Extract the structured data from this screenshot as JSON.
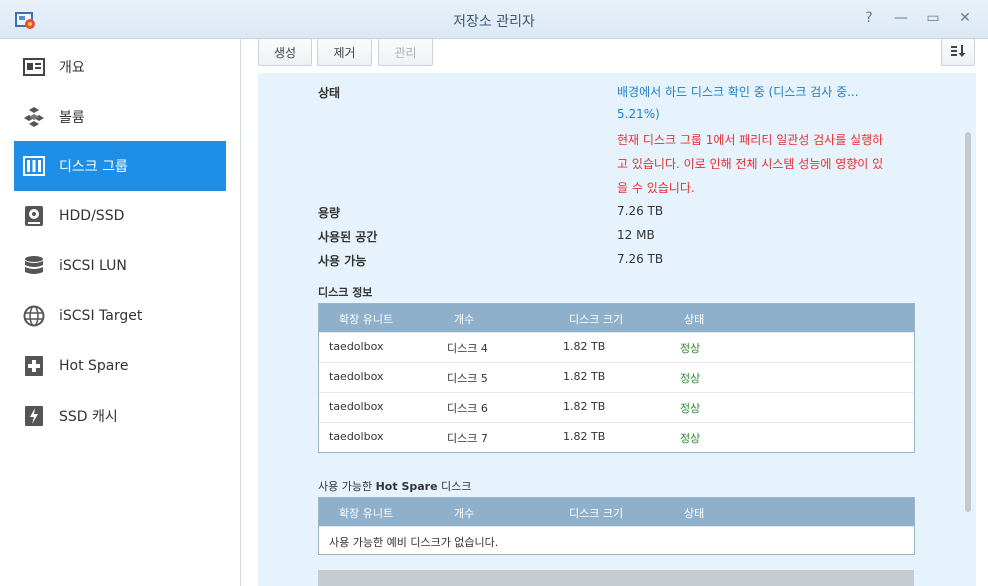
{
  "window": {
    "title": "저장소 관리자",
    "controls": [
      "?",
      "—",
      "▭",
      "✕"
    ]
  },
  "sidebar": {
    "items": [
      {
        "label": "개요",
        "icon": "overview-icon",
        "active": false
      },
      {
        "label": "볼륨",
        "icon": "volume-icon",
        "active": false
      },
      {
        "label": "디스크 그룹",
        "icon": "disk-group-icon",
        "active": true
      },
      {
        "label": "HDD/SSD",
        "icon": "hdd-icon",
        "active": false
      },
      {
        "label": "iSCSI LUN",
        "icon": "database-icon",
        "active": false
      },
      {
        "label": "iSCSI Target",
        "icon": "globe-icon",
        "active": false
      },
      {
        "label": "Hot Spare",
        "icon": "plus-box-icon",
        "active": false
      },
      {
        "label": "SSD 캐시",
        "icon": "lightning-icon",
        "active": false
      }
    ]
  },
  "toolbar": {
    "create_label": "생성",
    "remove_label": "제거",
    "manage_label": "관리",
    "sort_icon": "sort-icon"
  },
  "details": {
    "status_label": "상태",
    "status_line1": "배경에서 하드 디스크 확인 중 (디스크 검사 중...",
    "status_line2": "5.21%)",
    "warning_line1": "현재 디스크 그룹 1에서 패리티 일관성 검사를 실행하",
    "warning_line2": "고 있습니다. 이로 인해 전체 시스템 성능에 영향이 있",
    "warning_line3": "을 수 있습니다.",
    "capacity_label": "용량",
    "capacity_value": "7.26 TB",
    "used_label": "사용된 공간",
    "used_value": "12 MB",
    "available_label": "사용 가능",
    "available_value": "7.26 TB"
  },
  "disk_info": {
    "title": "디스크 정보",
    "columns": [
      "확장 유니트",
      "개수",
      "디스크 크기",
      "상태"
    ],
    "rows": [
      [
        "taedolbox",
        "디스크 4",
        "1.82 TB",
        "정상"
      ],
      [
        "taedolbox",
        "디스크 5",
        "1.82 TB",
        "정상"
      ],
      [
        "taedolbox",
        "디스크 6",
        "1.82 TB",
        "정상"
      ],
      [
        "taedolbox",
        "디스크 7",
        "1.82 TB",
        "정상"
      ]
    ]
  },
  "hot_spare": {
    "title_prefix": "사용 가능한 ",
    "title_bold": "Hot Spare",
    "title_suffix": " 디스크",
    "columns": [
      "확장 유니트",
      "개수",
      "디스크 크기",
      "상태"
    ],
    "empty_message": "사용 가능한 예비 디스크가 없습니다."
  },
  "colors": {
    "accent": "#1f8ee6",
    "status_blue": "#1f7fc4",
    "warning_red": "#e63030",
    "ok_green": "#2e8b2e",
    "table_header": "#8fb0cb"
  }
}
